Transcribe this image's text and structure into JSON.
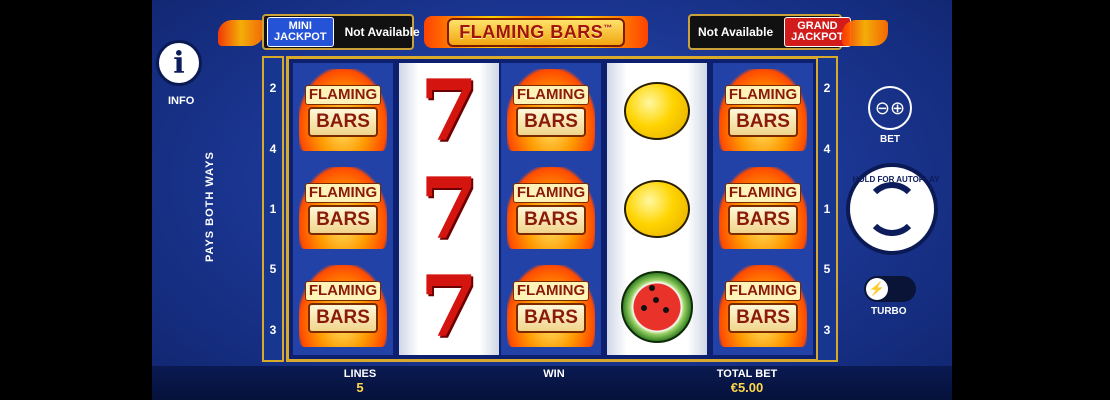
{
  "jackpots": {
    "mini": {
      "line1": "MINI",
      "line2": "JACKPOT",
      "value": "Not Available"
    },
    "grand": {
      "line1": "GRAND",
      "line2": "JACKPOT",
      "value": "Not Available"
    }
  },
  "title": {
    "word1": "FLAMING",
    "word2": "BARS",
    "tm": "™"
  },
  "info": {
    "label": "INFO",
    "icon": "info-icon"
  },
  "pays_label": "PAYS BOTH WAYS",
  "lines_left": [
    "2",
    "4",
    "1",
    "5",
    "3"
  ],
  "lines_right": [
    "2",
    "4",
    "1",
    "5",
    "3"
  ],
  "symbols": {
    "flaming_bars": {
      "top": "FLAMING",
      "bottom": "BARS"
    },
    "seven": "7"
  },
  "reels": [
    [
      "flaming_bars",
      "flaming_bars",
      "flaming_bars"
    ],
    [
      "seven",
      "seven",
      "seven"
    ],
    [
      "flaming_bars",
      "flaming_bars",
      "flaming_bars"
    ],
    [
      "lemon",
      "lemon",
      "watermelon"
    ],
    [
      "flaming_bars",
      "flaming_bars",
      "flaming_bars"
    ]
  ],
  "controls": {
    "bet_label": "BET",
    "bet_icon": "coin-stack-plus-minus-icon",
    "autoplay_label": "HOLD FOR AUTOPLAY",
    "turbo_label": "TURBO",
    "turbo_icon": "lightning-icon"
  },
  "bottom": {
    "lines_label": "LINES",
    "lines_value": "5",
    "win_label": "WIN",
    "win_value": "",
    "total_bet_label": "TOTAL BET",
    "total_bet_value": "€5.00"
  }
}
